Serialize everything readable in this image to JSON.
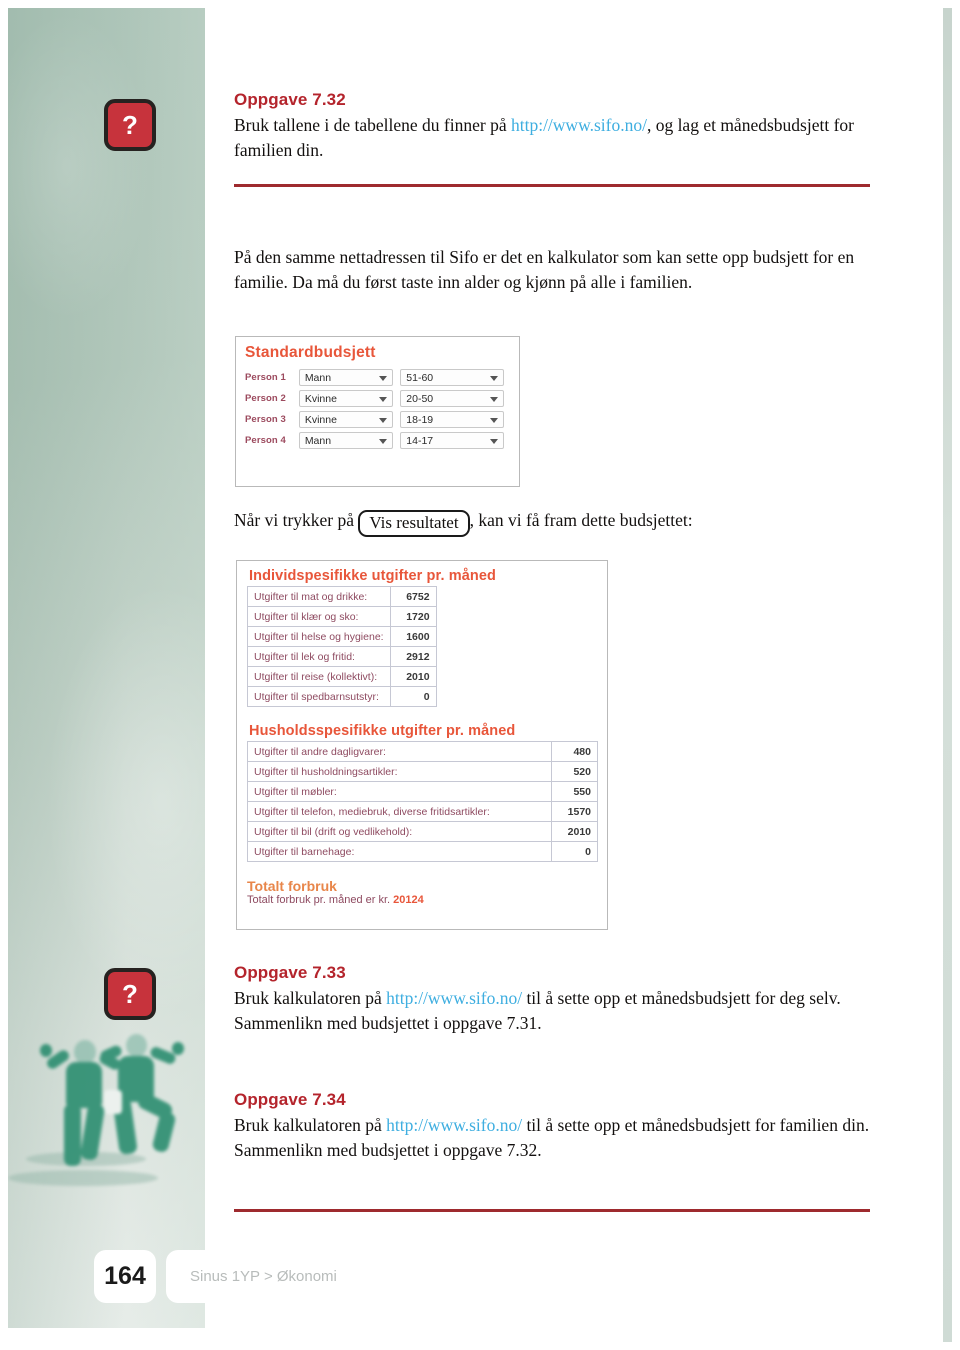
{
  "colors": {
    "accent_red": "#b4242c",
    "rule_red": "#9e2a2e",
    "link_blue": "#3eaee0",
    "screenshot_orange": "#e8563a",
    "sidebar_green": "#a9c2b5",
    "marker_red": "#c7333c"
  },
  "markers": {
    "question_glyph": "?"
  },
  "exercise_732": {
    "title": "Oppgave 7.32",
    "line1_before": "Bruk tallene i de tabellene du finner på ",
    "url": "http://www.sifo.no/",
    "line1_after": ", og lag et månedsbudsjett for familien din."
  },
  "intro": {
    "text": "På den samme nettadressen til Sifo er det en kalkulator som kan sette opp budsjett for en familie. Da må du først taste inn alder og kjønn på alle i familien."
  },
  "standardbudsjett": {
    "title": "Standardbudsjett",
    "rows": [
      {
        "label": "Person 1",
        "gender": "Mann",
        "age": "51-60"
      },
      {
        "label": "Person 2",
        "gender": "Kvinne",
        "age": "20-50"
      },
      {
        "label": "Person 3",
        "gender": "Kvinne",
        "age": "18-19"
      },
      {
        "label": "Person 4",
        "gender": "Mann",
        "age": "14-17"
      }
    ]
  },
  "result_sentence": {
    "before": "Når vi trykker på",
    "button": "Vis resultatet",
    "after": ",  kan vi få fram dette budsjettet:"
  },
  "budget": {
    "individual": {
      "heading": "Individspesifikke utgifter pr. måned",
      "rows": [
        {
          "label": "Utgifter til mat og drikke:",
          "value": "6752"
        },
        {
          "label": "Utgifter til klær og sko:",
          "value": "1720"
        },
        {
          "label": "Utgifter til helse og hygiene:",
          "value": "1600"
        },
        {
          "label": "Utgifter til lek og fritid:",
          "value": "2912"
        },
        {
          "label": "Utgifter til reise (kollektivt):",
          "value": "2010"
        },
        {
          "label": "Utgifter til spedbarnsutstyr:",
          "value": "0"
        }
      ]
    },
    "household": {
      "heading": "Husholdsspesifikke utgifter pr. måned",
      "rows": [
        {
          "label": "Utgifter til andre dagligvarer:",
          "value": "480"
        },
        {
          "label": "Utgifter til husholdningsartikler:",
          "value": "520"
        },
        {
          "label": "Utgifter til møbler:",
          "value": "550"
        },
        {
          "label": "Utgifter til telefon, mediebruk, diverse fritidsartikler:",
          "value": "1570"
        },
        {
          "label": "Utgifter til bil (drift og vedlikehold):",
          "value": "2010"
        },
        {
          "label": "Utgifter til barnehage:",
          "value": "0"
        }
      ]
    },
    "total": {
      "heading": "Totalt forbruk",
      "prefix": "Totalt forbruk pr. måned er kr. ",
      "amount": "20124"
    }
  },
  "exercise_733": {
    "title": "Oppgave 7.33",
    "before": "Bruk kalkulatoren på ",
    "url": "http://www.sifo.no/",
    "after": " til å sette opp et månedsbudsjett for deg selv.",
    "line2": "Sammenlikn med budsjettet i oppgave 7.31."
  },
  "exercise_734": {
    "title": "Oppgave 7.34",
    "before": "Bruk kalkulatoren på ",
    "url": "http://www.sifo.no/",
    "after": " til å sette opp et månedsbudsjett for familien din.",
    "line2": "Sammenlikn med budsjettet i oppgave 7.32."
  },
  "footer": {
    "page_number": "164",
    "breadcrumb": "Sinus 1YP  >  Økonomi"
  }
}
